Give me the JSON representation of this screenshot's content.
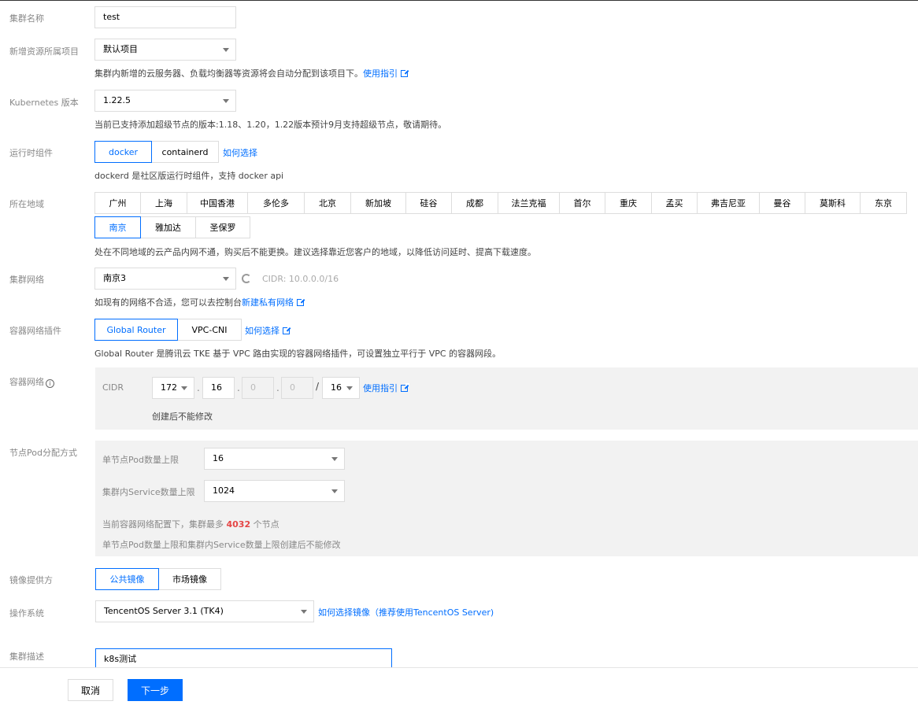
{
  "cluster_name": {
    "label": "集群名称",
    "value": "test"
  },
  "project": {
    "label": "新增资源所属项目",
    "value": "默认项目",
    "help": "集群内新增的云服务器、负载均衡器等资源将会自动分配到该项目下。",
    "help_link": "使用指引"
  },
  "k8s_version": {
    "label": "Kubernetes 版本",
    "value": "1.22.5",
    "help": "当前已支持添加超级节点的版本:1.18、1.20，1.22版本预计9月支持超级节点，敬请期待。"
  },
  "runtime": {
    "label": "运行时组件",
    "options": [
      "docker",
      "containerd"
    ],
    "selected": "docker",
    "link": "如何选择",
    "help": "dockerd 是社区版运行时组件，支持 docker api"
  },
  "region": {
    "label": "所在地域",
    "row1": [
      "广州",
      "上海",
      "中国香港",
      "多伦多",
      "北京",
      "新加坡",
      "硅谷",
      "成都",
      "法兰克福",
      "首尔",
      "重庆",
      "孟买",
      "弗吉尼亚",
      "曼谷",
      "莫斯科",
      "东京"
    ],
    "row2": [
      "南京",
      "雅加达",
      "圣保罗"
    ],
    "selected": "南京",
    "help": "处在不同地域的云产品内网不通，购买后不能更换。建议选择靠近您客户的地域，以降低访问延时、提高下载速度。"
  },
  "cluster_network": {
    "label": "集群网络",
    "value": "南京3",
    "cidr": "CIDR: 10.0.0.0/16",
    "help_prefix": "如现有的网络不合适，您可以去控制台",
    "help_link": "新建私有网络"
  },
  "network_plugin": {
    "label": "容器网络插件",
    "options": [
      "Global Router",
      "VPC-CNI"
    ],
    "selected": "Global Router",
    "link": "如何选择",
    "help": "Global Router 是腾讯云 TKE 基于 VPC 路由实现的容器网络插件，可设置独立平行于 VPC 的容器网段。"
  },
  "container_network": {
    "label": "容器网络",
    "info_icon": "i",
    "cidr_label": "CIDR",
    "octet1": "172",
    "octet2": "16",
    "octet3": "0",
    "octet4": "0",
    "dot": ".",
    "slash": "/",
    "mask": "16",
    "link": "使用指引",
    "note": "创建后不能修改"
  },
  "pod_alloc": {
    "label": "节点Pod分配方式",
    "pod_limit_label": "单节点Pod数量上限",
    "pod_limit_value": "16",
    "svc_limit_label": "集群内Service数量上限",
    "svc_limit_value": "1024",
    "note_prefix": "当前容器网络配置下，集群最多",
    "note_count": "4032",
    "note_suffix": "个节点",
    "note2": "单节点Pod数量上限和集群内Service数量上限创建后不能修改"
  },
  "image_provider": {
    "label": "镜像提供方",
    "options": [
      "公共镜像",
      "市场镜像"
    ],
    "selected": "公共镜像"
  },
  "os": {
    "label": "操作系统",
    "value": "TencentOS Server 3.1 (TK4)",
    "link": "如何选择镜像（推荐使用TencentOS Server)"
  },
  "description": {
    "label": "集群描述",
    "value": "k8s测试"
  },
  "footer": {
    "cancel": "取消",
    "next": "下一步"
  },
  "colors": {
    "accent": "#006eff",
    "danger": "#e54545",
    "panel": "#f2f2f2"
  }
}
